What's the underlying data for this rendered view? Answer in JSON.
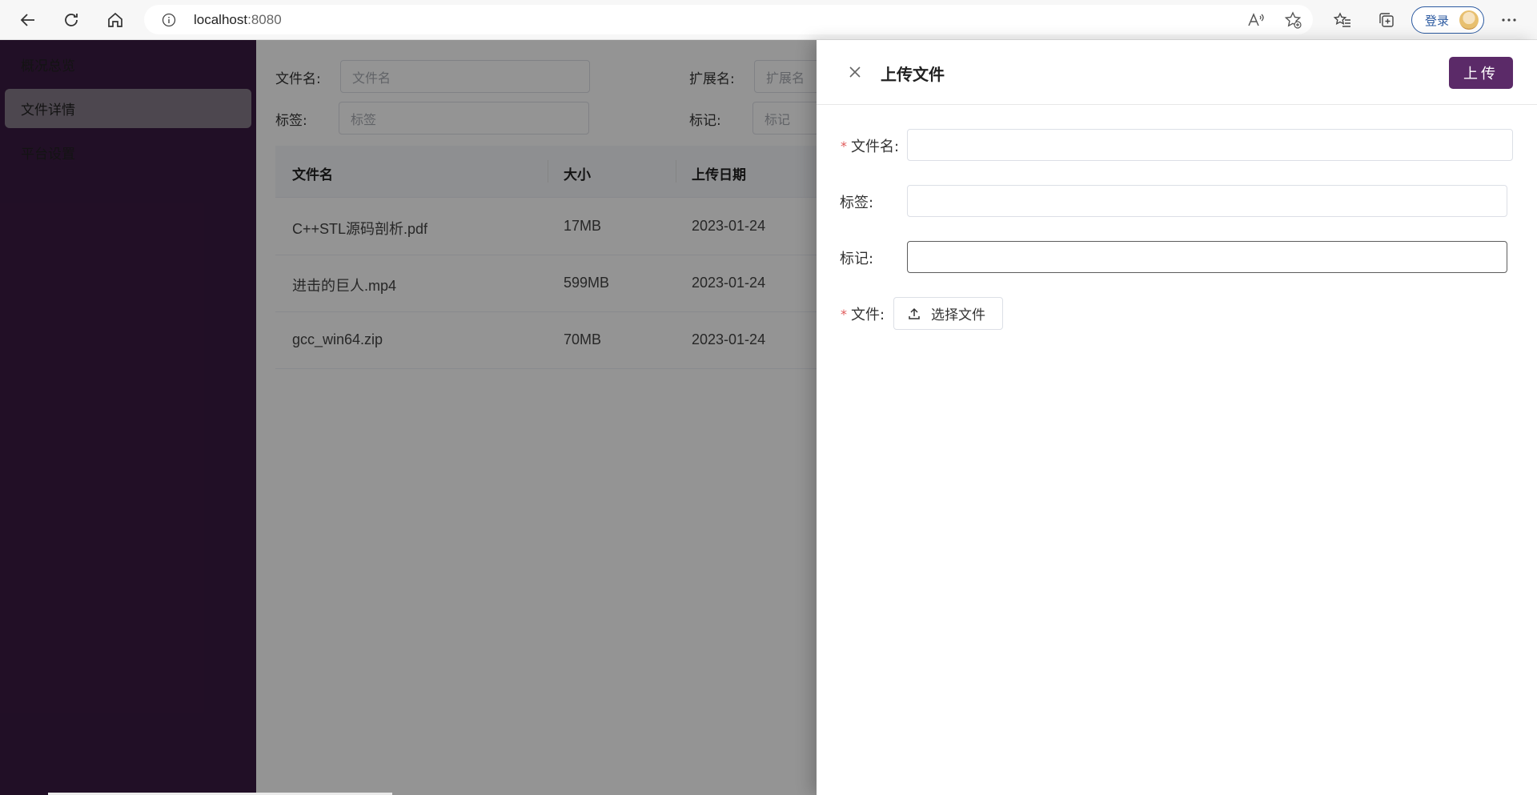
{
  "browser": {
    "url_host": "localhost",
    "url_port": ":8080",
    "login_label": "登录"
  },
  "sidebar": {
    "items": [
      {
        "label": "概况总览",
        "active": false
      },
      {
        "label": "文件详情",
        "active": true
      },
      {
        "label": "平台设置",
        "active": false
      }
    ]
  },
  "filters": {
    "filename_label": "文件名:",
    "filename_placeholder": "文件名",
    "ext_label": "扩展名:",
    "ext_placeholder": "扩展名",
    "tag_label": "标签:",
    "tag_placeholder": "标签",
    "mark_label": "标记:",
    "mark_placeholder": "标记"
  },
  "table": {
    "headers": [
      "文件名",
      "大小",
      "上传日期"
    ],
    "rows": [
      [
        "C++STL源码剖析.pdf",
        "17MB",
        "2023-01-24"
      ],
      [
        "进击的巨人.mp4",
        "599MB",
        "2023-01-24"
      ],
      [
        "gcc_win64.zip",
        "70MB",
        "2023-01-24"
      ]
    ]
  },
  "drawer": {
    "title": "上传文件",
    "upload_button": "上传",
    "fields": {
      "filename_label": "文件名:",
      "filename_value": "",
      "tag_label": "标签:",
      "tag_value": "",
      "mark_label": "标记:",
      "mark_value": "",
      "file_label": "文件:",
      "select_file_button": "选择文件"
    }
  },
  "colors": {
    "sidebar_bg": "#3a1a42",
    "primary": "#5b2a68",
    "required": "#e05a5a"
  }
}
